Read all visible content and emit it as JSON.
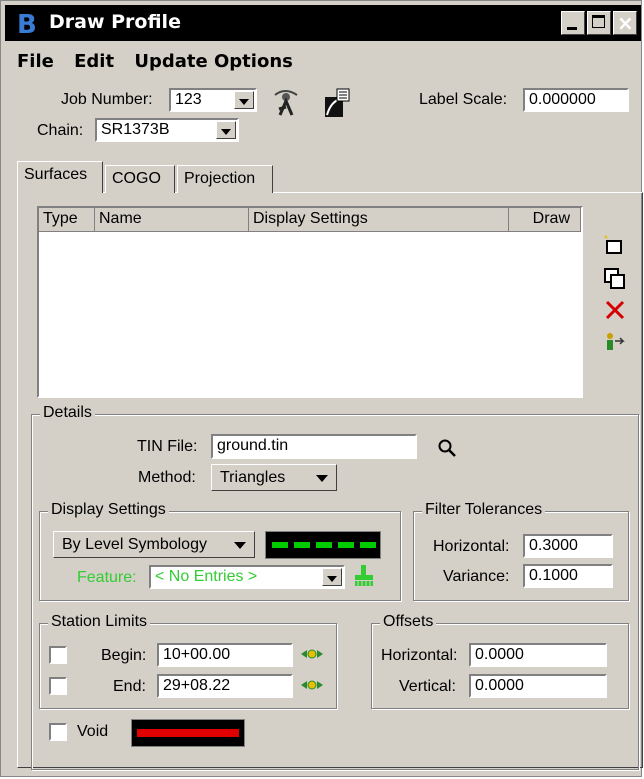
{
  "window": {
    "title": "Draw Profile"
  },
  "menu": [
    "File",
    "Edit",
    "Update Options"
  ],
  "job": {
    "label": "Job Number:",
    "value": "123"
  },
  "chain": {
    "label": "Chain:",
    "value": "SR1373B"
  },
  "label_scale": {
    "label": "Label Scale:",
    "value": "0.000000"
  },
  "tabs": [
    "Surfaces",
    "COGO",
    "Projection"
  ],
  "list_headers": [
    "Type",
    "Name",
    "Display Settings",
    "Draw"
  ],
  "details": {
    "title": "Details",
    "tin_label": "TIN File:",
    "tin_value": "ground.tin",
    "method_label": "Method:",
    "method_value": "Triangles"
  },
  "display_settings": {
    "title": "Display Settings",
    "symbology": "By Level Symbology",
    "feature_label": "Feature:",
    "feature_value": "< No Entries >",
    "colors": {
      "line": "#00cc00",
      "feature_text": "#33cc33"
    }
  },
  "filter": {
    "title": "Filter Tolerances",
    "horizontal_label": "Horizontal:",
    "horizontal_value": "0.3000",
    "variance_label": "Variance:",
    "variance_value": "0.1000"
  },
  "station_limits": {
    "title": "Station Limits",
    "begin_label": "Begin:",
    "begin_value": "10+00.00",
    "end_label": "End:",
    "end_value": "29+08.22"
  },
  "offsets": {
    "title": "Offsets",
    "horizontal_label": "Horizontal:",
    "horizontal_value": "0.0000",
    "vertical_label": "Vertical:",
    "vertical_value": "0.0000"
  },
  "void": {
    "label": "Void",
    "color": "#e00000"
  }
}
